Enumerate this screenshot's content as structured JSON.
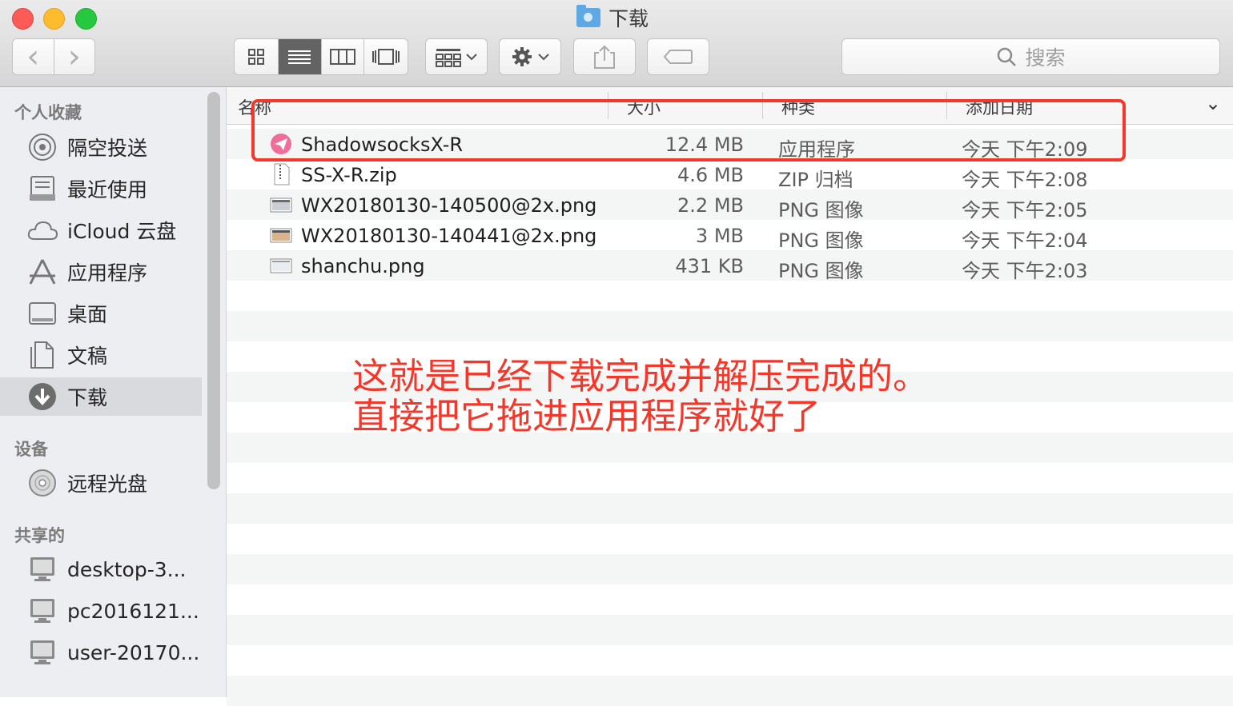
{
  "window": {
    "title": "下载"
  },
  "toolbar": {
    "back_glyph": "‹",
    "forward_glyph": "›",
    "search_placeholder": "搜索",
    "icons": [
      "grid-view-icon",
      "list-view-icon",
      "column-view-icon",
      "cover-flow-icon",
      "arrange-icon",
      "gear-icon",
      "share-icon",
      "tag-icon",
      "search-icon"
    ]
  },
  "sidebar": {
    "favorites_header": "个人收藏",
    "favorites": [
      {
        "label": "隔空投送",
        "icon": "airdrop-icon"
      },
      {
        "label": "最近使用",
        "icon": "recents-icon"
      },
      {
        "label": "iCloud 云盘",
        "icon": "cloud-icon"
      },
      {
        "label": "应用程序",
        "icon": "applications-icon"
      },
      {
        "label": "桌面",
        "icon": "desktop-icon"
      },
      {
        "label": "文稿",
        "icon": "documents-icon"
      },
      {
        "label": "下载",
        "icon": "downloads-icon",
        "selected": true
      }
    ],
    "devices_header": "设备",
    "devices": [
      {
        "label": "远程光盘",
        "icon": "disc-icon"
      }
    ],
    "shared_header": "共享的",
    "shared": [
      {
        "label": "desktop-3...",
        "icon": "computer-icon"
      },
      {
        "label": "pc2016121...",
        "icon": "computer-icon"
      },
      {
        "label": "user-20170...",
        "icon": "computer-icon"
      }
    ]
  },
  "columns": {
    "name": "名称",
    "size": "大小",
    "kind": "种类",
    "date": "添加日期",
    "chevron": "⌄"
  },
  "files": [
    {
      "name": "ShadowsocksX-R",
      "size": "12.4 MB",
      "kind": "应用程序",
      "date": "今天 下午2:09",
      "icon": "app-icon"
    },
    {
      "name": "SS-X-R.zip",
      "size": "4.6 MB",
      "kind": "ZIP 归档",
      "date": "今天 下午2:08",
      "icon": "zip-icon"
    },
    {
      "name": "WX20180130-140500@2x.png",
      "size": "2.2 MB",
      "kind": "PNG 图像",
      "date": "今天 下午2:05",
      "icon": "image-icon"
    },
    {
      "name": "WX20180130-140441@2x.png",
      "size": "3 MB",
      "kind": "PNG 图像",
      "date": "今天 下午2:04",
      "icon": "image-icon"
    },
    {
      "name": "shanchu.png",
      "size": "431 KB",
      "kind": "PNG 图像",
      "date": "今天 下午2:03",
      "icon": "image-icon"
    }
  ],
  "annotation": {
    "line1": "这就是已经下载完成并解压完成的。",
    "line2": "直接把它拖进应用程序就好了"
  },
  "colors": {
    "highlight": "#f4372b",
    "selected_bg": "#d9dadd"
  }
}
